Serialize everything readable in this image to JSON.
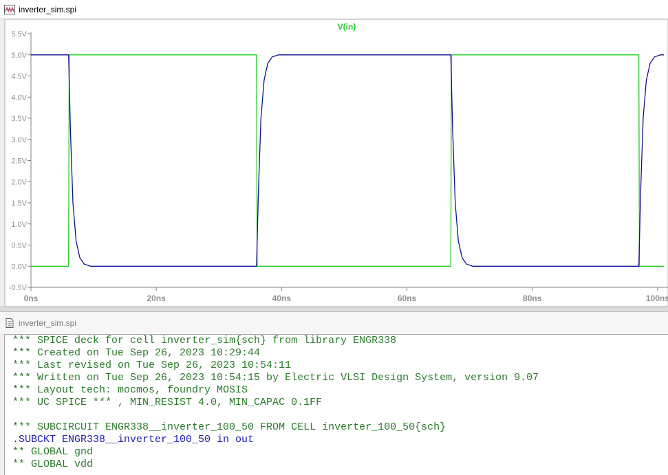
{
  "plot_window": {
    "title": "inverter_sim.spi"
  },
  "chart_data": {
    "type": "line",
    "title": "V(in)",
    "xlabel": "",
    "ylabel": "",
    "x_unit": "ns",
    "xlim": [
      0,
      101
    ],
    "ylim": [
      -0.5,
      5.5
    ],
    "x_ticks": [
      "0ns",
      "20ns",
      "40ns",
      "60ns",
      "80ns",
      "100ns"
    ],
    "y_ticks": [
      "5.5V",
      "5.0V",
      "4.5V",
      "4.0V",
      "3.5V",
      "3.0V",
      "2.5V",
      "2.0V",
      "1.5V",
      "1.0V",
      "0.5V",
      "0.0V",
      "-0.5V"
    ],
    "grid": false,
    "series": [
      {
        "name": "V(in)",
        "color": "#22cc22",
        "x": [
          0,
          6,
          6.1,
          36,
          36.1,
          67,
          67.1,
          97,
          97.1,
          101
        ],
        "y": [
          0,
          0,
          5,
          5,
          0,
          0,
          5,
          5,
          0,
          0
        ]
      },
      {
        "color": "#101090",
        "x": [
          0,
          6,
          6.3,
          6.7,
          7.2,
          7.8,
          8.5,
          9.5,
          36,
          36.3,
          36.7,
          37.2,
          37.8,
          38.5,
          39.5,
          67,
          67.3,
          67.7,
          68.2,
          68.8,
          69.5,
          70.5,
          97,
          97.3,
          97.7,
          98.2,
          98.8,
          99.5,
          100.5,
          101
        ],
        "y": [
          5,
          5,
          3.2,
          1.5,
          0.6,
          0.2,
          0.05,
          0,
          0,
          1.8,
          3.5,
          4.4,
          4.8,
          4.95,
          5,
          5,
          3.2,
          1.5,
          0.6,
          0.2,
          0.05,
          0,
          0,
          1.8,
          3.5,
          4.4,
          4.8,
          4.95,
          5,
          5
        ]
      }
    ]
  },
  "text_window": {
    "title": "inverter_sim.spi"
  },
  "netlist": {
    "lines": [
      {
        "text": "*** SPICE deck for cell inverter_sim{sch} from library ENGR338",
        "color": "green"
      },
      {
        "text": "*** Created on Tue Sep 26, 2023 10:29:44",
        "color": "green"
      },
      {
        "text": "*** Last revised on Tue Sep 26, 2023 10:54:11",
        "color": "green"
      },
      {
        "text": "*** Written on Tue Sep 26, 2023 10:54:15 by Electric VLSI Design System, version 9.07",
        "color": "green"
      },
      {
        "text": "*** Layout tech: mocmos, foundry MOSIS",
        "color": "green"
      },
      {
        "text": "*** UC SPICE *** , MIN_RESIST 4.0, MIN_CAPAC 0.1FF",
        "color": "green"
      },
      {
        "text": "",
        "color": "green"
      },
      {
        "text": "*** SUBCIRCUIT ENGR338__inverter_100_50 FROM CELL inverter_100_50{sch}",
        "color": "green"
      },
      {
        "text": ".SUBCKT ENGR338__inverter_100_50 in out",
        "color": "blue"
      },
      {
        "text": "** GLOBAL gnd",
        "color": "green"
      },
      {
        "text": "** GLOBAL vdd",
        "color": "green"
      }
    ]
  }
}
